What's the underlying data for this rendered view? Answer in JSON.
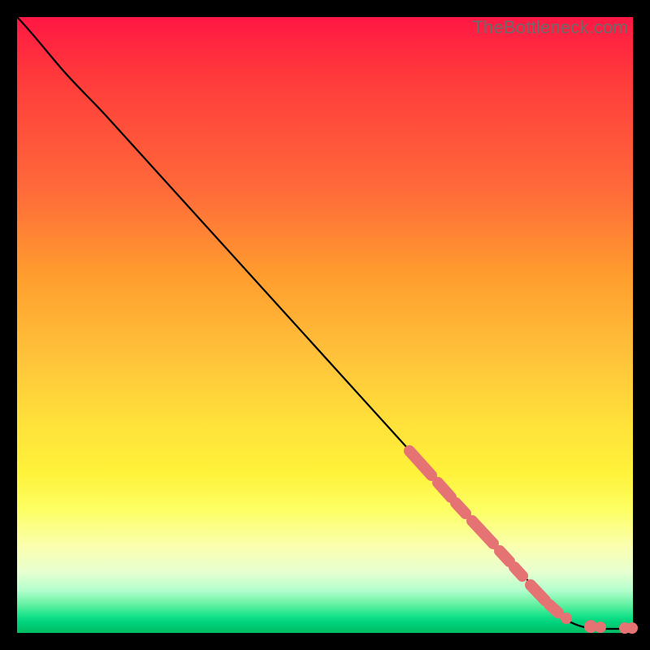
{
  "watermark": "TheBottleneck.com",
  "colors": {
    "marker": "#e57373",
    "curve": "#000000",
    "frame": "#000000"
  },
  "chart_data": {
    "type": "line",
    "title": "",
    "xlabel": "",
    "ylabel": "",
    "xlim": [
      0,
      100
    ],
    "ylim": [
      0,
      100
    ],
    "grid": false,
    "legend": false,
    "note": "Axes and tick labels are not rendered; x and y are normalized percentages of the plot area (0 = left/bottom, 100 = right/top). Values are estimated from pixel positions.",
    "series": [
      {
        "name": "curve",
        "kind": "line",
        "x": [
          0,
          3,
          6,
          9,
          12,
          20,
          30,
          40,
          50,
          60,
          70,
          80,
          86,
          89,
          92,
          96,
          100
        ],
        "y": [
          100,
          97.5,
          94.5,
          91,
          88,
          79,
          67.5,
          56,
          44.5,
          33,
          22,
          11,
          5,
          2.5,
          1,
          0.5,
          0.5
        ]
      },
      {
        "name": "highlighted-points",
        "kind": "scatter",
        "x": [
          64,
          65.5,
          67,
          69,
          70.5,
          72,
          74,
          76.5,
          78,
          80,
          81.5,
          83,
          85.5,
          87,
          88.5,
          93,
          94.5,
          99,
          100
        ],
        "y": [
          29,
          27.5,
          26,
          24,
          22.5,
          21,
          18.5,
          16,
          14.5,
          12,
          10.5,
          9,
          6.5,
          5,
          3.5,
          1,
          0.8,
          0.6,
          0.6
        ]
      }
    ]
  }
}
